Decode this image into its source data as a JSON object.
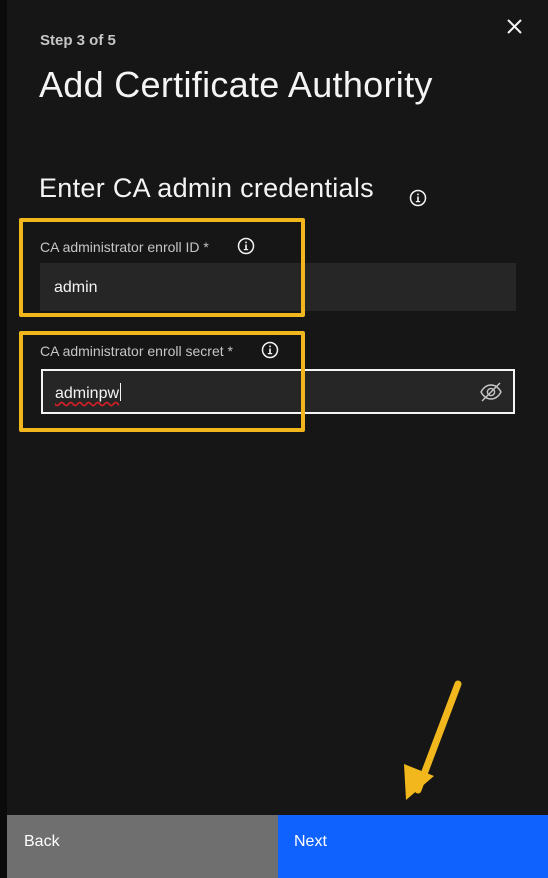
{
  "header": {
    "step": "Step 3 of 5",
    "title": "Add Certificate Authority",
    "close_icon": "close-icon"
  },
  "section": {
    "subtitle": "Enter CA admin credentials",
    "info_icon": "info-icon"
  },
  "fields": {
    "enroll_id": {
      "label": "CA administrator enroll ID *",
      "value": "admin"
    },
    "enroll_secret": {
      "label": "CA administrator enroll secret *",
      "value": "adminpw",
      "toggle_icon": "eye-hidden-icon"
    }
  },
  "footer": {
    "back_label": "Back",
    "next_label": "Next"
  },
  "colors": {
    "background": "#161616",
    "highlight": "#f1b71c",
    "primary": "#0f62fe",
    "secondary": "#6f6f6f"
  }
}
